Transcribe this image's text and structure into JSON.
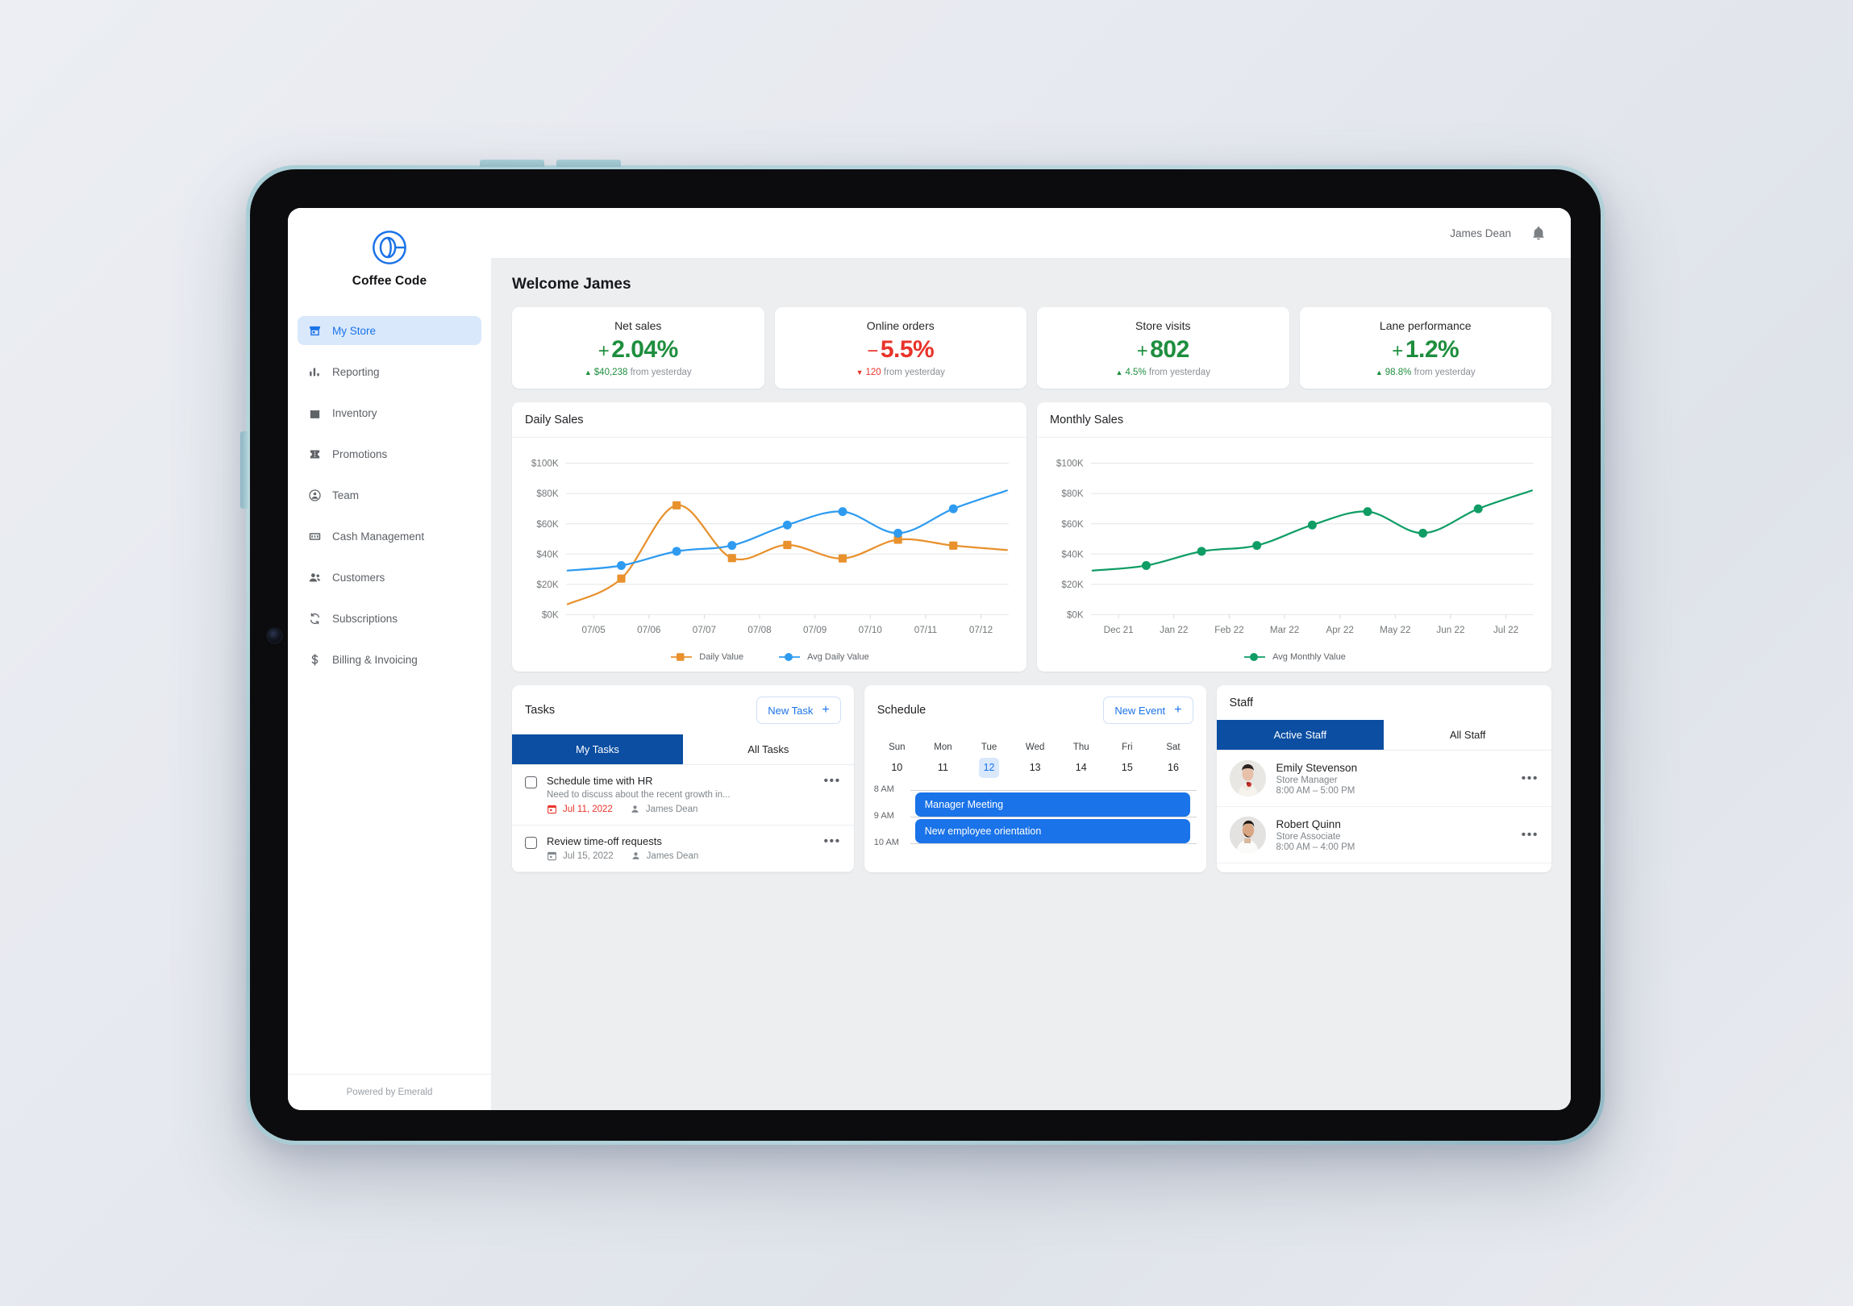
{
  "brand": {
    "name": "Coffee Code",
    "footer": "Powered by Emerald"
  },
  "topbar": {
    "user_name": "James Dean",
    "bell_icon": "notification-bell-icon"
  },
  "sidebar": {
    "items": [
      {
        "label": "My Store",
        "icon": "store-icon",
        "active": true
      },
      {
        "label": "Reporting",
        "icon": "bar-chart-icon",
        "active": false
      },
      {
        "label": "Inventory",
        "icon": "inventory-bag-icon",
        "active": false
      },
      {
        "label": "Promotions",
        "icon": "ticket-icon",
        "active": false
      },
      {
        "label": "Team",
        "icon": "team-circle-icon",
        "active": false
      },
      {
        "label": "Cash Management",
        "icon": "banknote-icon",
        "active": false
      },
      {
        "label": "Customers",
        "icon": "people-icon",
        "active": false
      },
      {
        "label": "Subscriptions",
        "icon": "refresh-cycle-icon",
        "active": false
      },
      {
        "label": "Billing & Invoicing",
        "icon": "dollar-sign-icon",
        "active": false
      }
    ]
  },
  "main": {
    "welcome": "Welcome James",
    "kpis": [
      {
        "title": "Net sales",
        "sign": "+",
        "value": "2.04%",
        "direction": "up",
        "arrow": "▲",
        "delta": "$40,238",
        "sub_suffix": "from yesterday"
      },
      {
        "title": "Online orders",
        "sign": "−",
        "value": "5.5%",
        "direction": "down",
        "arrow": "▼",
        "delta": "120",
        "sub_suffix": "from yesterday"
      },
      {
        "title": "Store visits",
        "sign": "+",
        "value": "802",
        "direction": "up",
        "arrow": "▲",
        "delta": "4.5%",
        "sub_suffix": "from yesterday"
      },
      {
        "title": "Lane performance",
        "sign": "+",
        "value": "1.2%",
        "direction": "up",
        "arrow": "▲",
        "delta": "98.8%",
        "sub_suffix": "from yesterday"
      }
    ]
  },
  "chart_data": [
    {
      "type": "line",
      "title": "Daily Sales",
      "xlabel": "",
      "ylabel": "",
      "x": [
        "07/05",
        "07/06",
        "07/07",
        "07/08",
        "07/09",
        "07/10",
        "07/11",
        "07/12"
      ],
      "ytick_labels": [
        "$0K",
        "$20K",
        "$40K",
        "$60K",
        "$80K",
        "$100K"
      ],
      "ytick_values": [
        0,
        20000,
        40000,
        60000,
        80000,
        100000
      ],
      "ylim": [
        0,
        105000
      ],
      "grid": true,
      "legend_position": "bottom",
      "series": [
        {
          "name": "Daily Value",
          "color": "#e8912d",
          "marker": "square",
          "points": [
            {
              "x": "07/05",
              "value": 23800
            },
            {
              "x": "07/06",
              "value": 72200
            },
            {
              "x": "07/07",
              "value": 37300
            },
            {
              "x": "07/08",
              "value": 46000
            },
            {
              "x": "07/09",
              "value": 37100
            },
            {
              "x": "07/10",
              "value": 49500
            },
            {
              "x": "07/11",
              "value": 45600
            }
          ]
        },
        {
          "name": "Avg Daily Value",
          "color": "#2e9bf0",
          "marker": "circle",
          "points": [
            {
              "x": "07/05",
              "value": 32400
            },
            {
              "x": "07/06",
              "value": 41800
            },
            {
              "x": "07/07",
              "value": 45700
            },
            {
              "x": "07/08",
              "value": 59200
            },
            {
              "x": "07/09",
              "value": 68000
            },
            {
              "x": "07/10",
              "value": 53800
            },
            {
              "x": "07/11",
              "value": 69900
            }
          ]
        }
      ]
    },
    {
      "type": "line",
      "title": "Monthly Sales",
      "xlabel": "",
      "ylabel": "",
      "x": [
        "Dec 21",
        "Jan 22",
        "Feb 22",
        "Mar 22",
        "Apr 22",
        "May 22",
        "Jun 22",
        "Jul 22"
      ],
      "ytick_labels": [
        "$0K",
        "$20K",
        "$40K",
        "$60K",
        "$80K",
        "$100K"
      ],
      "ytick_values": [
        0,
        20000,
        40000,
        60000,
        80000,
        100000
      ],
      "ylim": [
        0,
        105000
      ],
      "grid": true,
      "legend_position": "bottom",
      "series": [
        {
          "name": "Avg Monthly Value",
          "color": "#0f9d65",
          "marker": "circle",
          "points": [
            {
              "x": "Dec 21",
              "value": 32400
            },
            {
              "x": "Jan 22",
              "value": 41800
            },
            {
              "x": "Feb 22",
              "value": 45700
            },
            {
              "x": "Mar 22",
              "value": 59200
            },
            {
              "x": "Apr 22",
              "value": 68000
            },
            {
              "x": "May 22",
              "value": 53800
            },
            {
              "x": "Jun 22",
              "value": 69900
            }
          ]
        }
      ]
    }
  ],
  "tasks_panel": {
    "title": "Tasks",
    "new_button": "New Task",
    "tabs": [
      {
        "label": "My Tasks",
        "active": true
      },
      {
        "label": "All Tasks",
        "active": false
      }
    ],
    "items": [
      {
        "title": "Schedule time with HR",
        "description": "Need to discuss about the recent growth in...",
        "date": "Jul 11, 2022",
        "assignee": "James Dean",
        "overdue": true
      },
      {
        "title": "Review time-off requests",
        "description": "",
        "date": "Jul 15, 2022",
        "assignee": "James Dean",
        "overdue": false
      }
    ]
  },
  "schedule_panel": {
    "title": "Schedule",
    "new_button": "New Event",
    "days": [
      {
        "name": "Sun",
        "num": "10",
        "today": false
      },
      {
        "name": "Mon",
        "num": "11",
        "today": false
      },
      {
        "name": "Tue",
        "num": "12",
        "today": true
      },
      {
        "name": "Wed",
        "num": "13",
        "today": false
      },
      {
        "name": "Thu",
        "num": "14",
        "today": false
      },
      {
        "name": "Fri",
        "num": "15",
        "today": false
      },
      {
        "name": "Sat",
        "num": "16",
        "today": false
      }
    ],
    "times": [
      "8 AM",
      "9 AM",
      "10 AM"
    ],
    "events": [
      {
        "label": "Manager Meeting",
        "slot": 0
      },
      {
        "label": "New employee orientation",
        "slot": 1
      }
    ]
  },
  "staff_panel": {
    "title": "Staff",
    "tabs": [
      {
        "label": "Active Staff",
        "active": true
      },
      {
        "label": "All Staff",
        "active": false
      }
    ],
    "members": [
      {
        "name": "Emily Stevenson",
        "role": "Store Manager",
        "hours": "8:00 AM – 5:00 PM",
        "avatar": "avatar-emily"
      },
      {
        "name": "Robert Quinn",
        "role": "Store Associate",
        "hours": "8:00 AM – 4:00 PM",
        "avatar": "avatar-robert"
      }
    ]
  },
  "colors": {
    "accent_blue": "#1a73e8",
    "tab_active_blue": "#0b4ea2",
    "positive_green": "#1e8e3e",
    "negative_red": "#e8332a",
    "daily_orange": "#e8912d",
    "avg_blue": "#2e9bf0",
    "monthly_green": "#0f9d65"
  }
}
